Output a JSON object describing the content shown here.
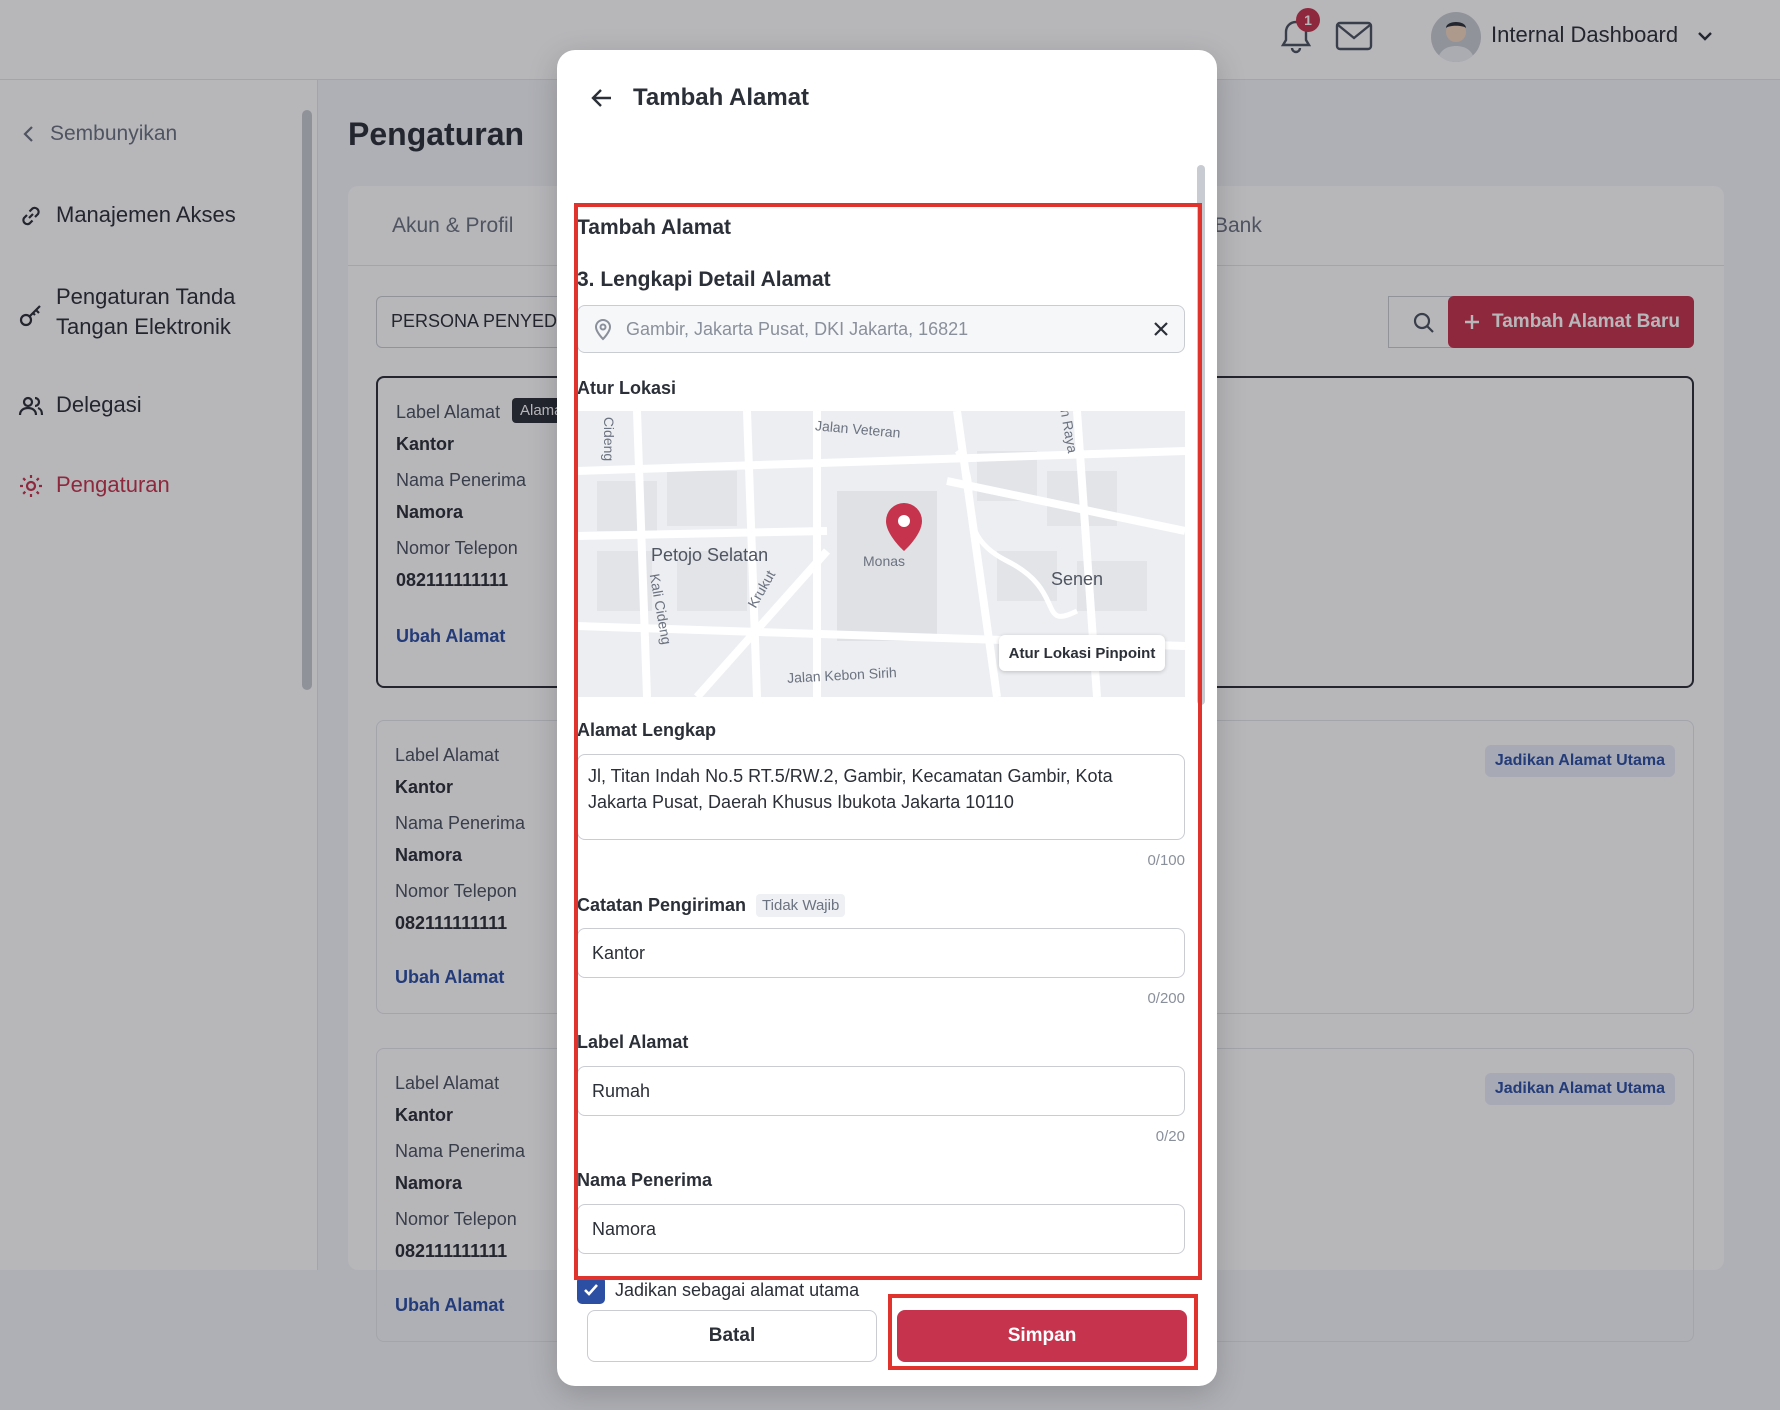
{
  "topbar": {
    "notification_count": "1",
    "user_name": "Internal Dashboard"
  },
  "sidebar": {
    "hide_label": "Sembunyikan",
    "items": [
      {
        "label": "Manajemen Akses",
        "icon": "link-icon"
      },
      {
        "label": "Pengaturan Tanda Tangan Elektronik",
        "icon": "key-icon"
      },
      {
        "label": "Delegasi",
        "icon": "users-icon"
      },
      {
        "label": "Pengaturan",
        "icon": "gear-icon"
      }
    ]
  },
  "page": {
    "title": "Pengaturan",
    "tabs": [
      "Akun & Profil",
      "Bank"
    ],
    "select_value": "PERSONA PENYEDIA",
    "add_button": "Tambah Alamat Baru",
    "cards": [
      {
        "label_title": "Label Alamat",
        "main_tag": "Alamat Utama",
        "label_value": "Kantor",
        "recipient_title": "Nama Penerima",
        "recipient_value": "Namora",
        "phone_title": "Nomor Telepon",
        "phone_value": "082111111111",
        "edit_link": "Ubah Alamat"
      },
      {
        "label_title": "Label Alamat",
        "label_value": "Kantor",
        "recipient_title": "Nama Penerima",
        "recipient_value": "Namora",
        "phone_title": "Nomor Telepon",
        "phone_value": "082111111111",
        "edit_link": "Ubah Alamat",
        "make_main": "Jadikan Alamat Utama"
      },
      {
        "label_title": "Label Alamat",
        "label_value": "Kantor",
        "recipient_title": "Nama Penerima",
        "recipient_value": "Namora",
        "phone_title": "Nomor Telepon",
        "phone_value": "082111111111",
        "edit_link": "Ubah Alamat",
        "make_main": "Jadikan Alamat Utama"
      }
    ]
  },
  "modal": {
    "title": "Tambah Alamat",
    "section_title": "Tambah Alamat",
    "step_title": "3. Lengkapi Detail Alamat",
    "location_placeholder": "Gambir, Jakarta Pusat, DKI Jakarta, 16821",
    "map_label": "Atur Lokasi",
    "map": {
      "places": [
        "Petojo Selatan",
        "Senen",
        "Monas"
      ],
      "streets": [
        "Jalan Veteran",
        "Jalan Kebon Sirih",
        "Kali Cideng",
        "Krukut",
        "Cideng",
        "n Raya"
      ],
      "pinpoint_button": "Atur Lokasi Pinpoint"
    },
    "full_address_label": "Alamat Lengkap",
    "full_address_value": "Jl, Titan Indah No.5 RT.5/RW.2, Gambir, Kecamatan Gambir, Kota Jakarta Pusat, Daerah Khusus Ibukota Jakarta 10110",
    "full_address_counter": "0/100",
    "delivery_note_label": "Catatan Pengiriman",
    "delivery_note_optional": "Tidak Wajib",
    "delivery_note_value": "Kantor",
    "delivery_note_counter": "0/200",
    "address_label_label": "Label Alamat",
    "address_label_value": "Rumah",
    "address_label_counter": "0/20",
    "recipient_label": "Nama Penerima",
    "recipient_value": "Namora",
    "main_address_checkbox": "Jadikan sebagai alamat utama",
    "main_address_checked": true,
    "cancel_button": "Batal",
    "save_button": "Simpan"
  },
  "colors": {
    "brand_red": "#c5334d",
    "link_blue": "#2c4ea3",
    "highlight_red": "#e0332d"
  }
}
